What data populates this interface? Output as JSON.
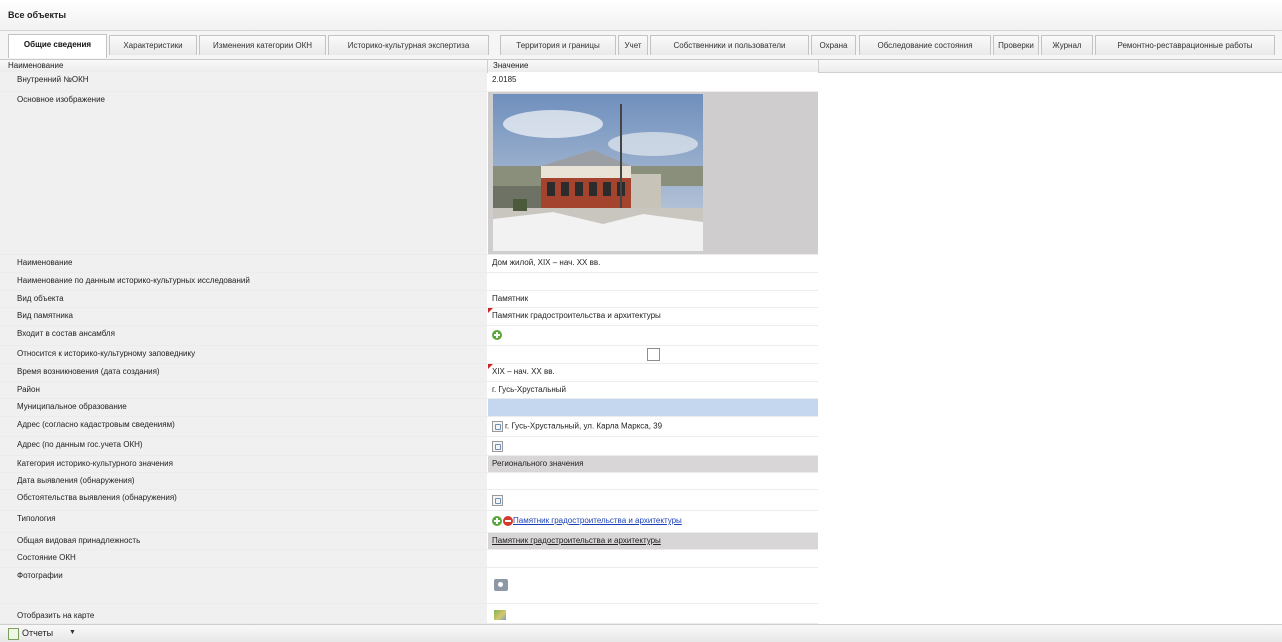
{
  "window": {
    "title": "Все объекты"
  },
  "tabs": [
    {
      "label": "Общие сведения",
      "active": true
    },
    {
      "label": "Характеристики"
    },
    {
      "label": "Изменения категории ОКН"
    },
    {
      "label": "Историко-культурная экспертиза"
    },
    {
      "label": "Территория и границы"
    },
    {
      "label": "Учет"
    },
    {
      "label": "Собственники и пользователи"
    },
    {
      "label": "Охрана"
    },
    {
      "label": "Обследование состояния"
    },
    {
      "label": "Проверки"
    },
    {
      "label": "Журнал"
    },
    {
      "label": "Ремонтно-реставрационные работы"
    }
  ],
  "columns": {
    "name": "Наименование",
    "value": "Значение"
  },
  "rows": {
    "internal_no": {
      "label": "Внутренний №ОКН",
      "value": "2.0185"
    },
    "main_image": {
      "label": "Основное изображение"
    },
    "name": {
      "label": "Наименование",
      "value": "Дом жилой, XIX – нач. XX вв."
    },
    "name_research": {
      "label": "Наименование по данным историко-культурных исследований",
      "value": ""
    },
    "object_kind": {
      "label": "Вид объекта",
      "value": "Памятник"
    },
    "monument_kind": {
      "label": "Вид памятника",
      "value": "Памятник градостроительства и архитектуры"
    },
    "ensemble": {
      "label": "Входит в состав ансамбля"
    },
    "reserve": {
      "label": "Относится к историко-культурному заповеднику"
    },
    "creation_time": {
      "label": "Время возникновения (дата создания)",
      "value": "XIX – нач. XX вв."
    },
    "district": {
      "label": "Район",
      "value": "г. Гусь-Хрустальный"
    },
    "municipality": {
      "label": "Муниципальное образование",
      "value": ""
    },
    "address_cadastre": {
      "label": "Адрес (согласно кадастровым сведениям)",
      "value": "г. Гусь-Хрустальный, ул. Карла Маркса, 39"
    },
    "address_state": {
      "label": "Адрес (по данным гос.учета ОКН)",
      "value": ""
    },
    "category": {
      "label": "Категория историко-культурного значения",
      "value": "Регионального значения"
    },
    "discovery_date": {
      "label": "Дата выявления (обнаружения)",
      "value": ""
    },
    "discovery_circumstances": {
      "label": "Обстоятельства выявления (обнаружения)",
      "value": ""
    },
    "typology": {
      "label": "Типология",
      "value": "Памятник градостроительства и архитектуры"
    },
    "general_species": {
      "label": "Общая видовая принадлежность",
      "value": "Памятник градостроительства и архитектуры"
    },
    "state": {
      "label": "Состояние ОКН",
      "value": ""
    },
    "photos": {
      "label": "Фотографии"
    },
    "map": {
      "label": "Отобразить на карте"
    }
  },
  "footer": {
    "reports_label": "Отчеты",
    "caret": "▼"
  },
  "colors": {
    "grey_cell": "#cfcdcd",
    "blue_cell": "#c4d7ef",
    "link": "#1a3fb8",
    "required_marker": "#c62828"
  },
  "icons": {
    "add": "plus-circle-icon",
    "remove": "minus-circle-icon",
    "address": "address-picker-icon",
    "photo": "camera-icon",
    "map": "map-icon",
    "reports": "document-icon"
  }
}
